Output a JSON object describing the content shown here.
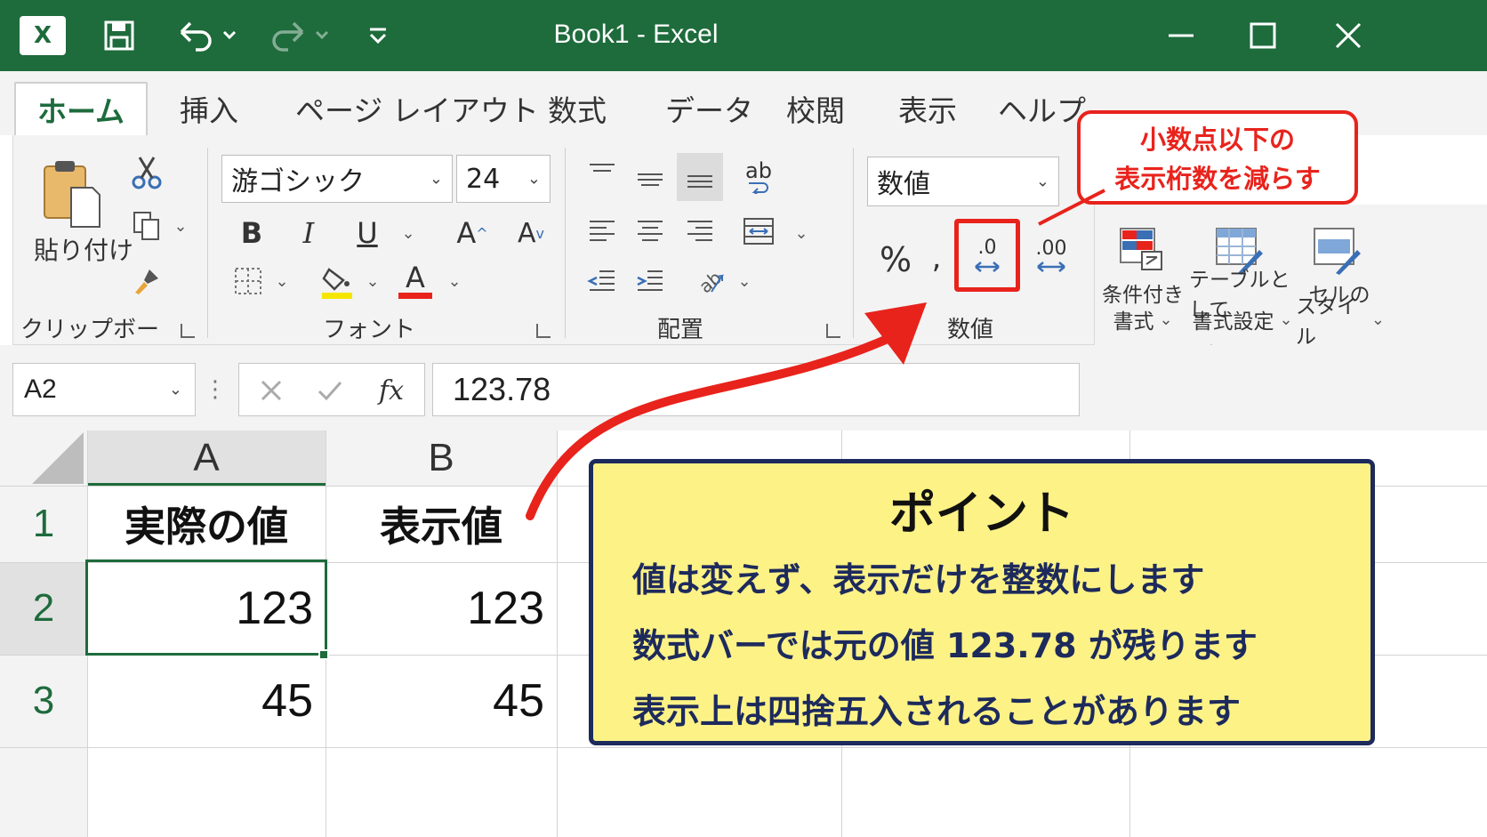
{
  "window": {
    "title": "Book1  -  Excel",
    "app_logo": "X",
    "accent_color": "#1e6b3c"
  },
  "tabs": [
    "ホーム",
    "挿入",
    "ページ レイアウト",
    "数式",
    "データ",
    "校閲",
    "表示",
    "ヘルプ"
  ],
  "ribbon": {
    "clipboard": {
      "paste_label": "貼り付け",
      "group_label": "クリップボード"
    },
    "font": {
      "name": "游ゴシック",
      "size": "24",
      "bold": "B",
      "italic": "I",
      "underline": "U",
      "grow": "A",
      "shrink": "A",
      "color_letter": "A",
      "group_label": "フォント"
    },
    "alignment": {
      "wrap_glyph": "ab",
      "group_label": "配置"
    },
    "number": {
      "format": "数値",
      "percent": "%",
      "comma": ",",
      "decrease_decimal": ".0",
      "increase_decimal": ".00",
      "group_label": "数値"
    },
    "styles": {
      "conditional": [
        "条件付き",
        "書式"
      ],
      "as_table": [
        "テーブルとして",
        "書式設定"
      ],
      "cell_style": [
        "セルの",
        "スタイル"
      ],
      "group_label": "スタイル"
    }
  },
  "formula_bar": {
    "name_box": "A2",
    "fx": "fx",
    "value": "123.78"
  },
  "sheet": {
    "columns": [
      "A",
      "B"
    ],
    "rows": [
      "1",
      "2",
      "3"
    ],
    "cells": {
      "A1": "実際の値",
      "B1": "表示値",
      "A2": "123",
      "B2": "123",
      "A3": "45",
      "B3": "45"
    }
  },
  "callouts": {
    "decrease_decimal": [
      "小数点以下の",
      "表示桁数を減らす"
    ],
    "point": {
      "title": "ポイント",
      "lines": [
        "値は変えず、表示だけを整数にします",
        "数式バーでは元の値 123.78 が残ります",
        "表示上は四捨五入されることがあります"
      ]
    }
  },
  "colors": {
    "highlight_red": "#e8231c",
    "point_bg": "#fdf286",
    "point_border": "#1d2a5c"
  }
}
